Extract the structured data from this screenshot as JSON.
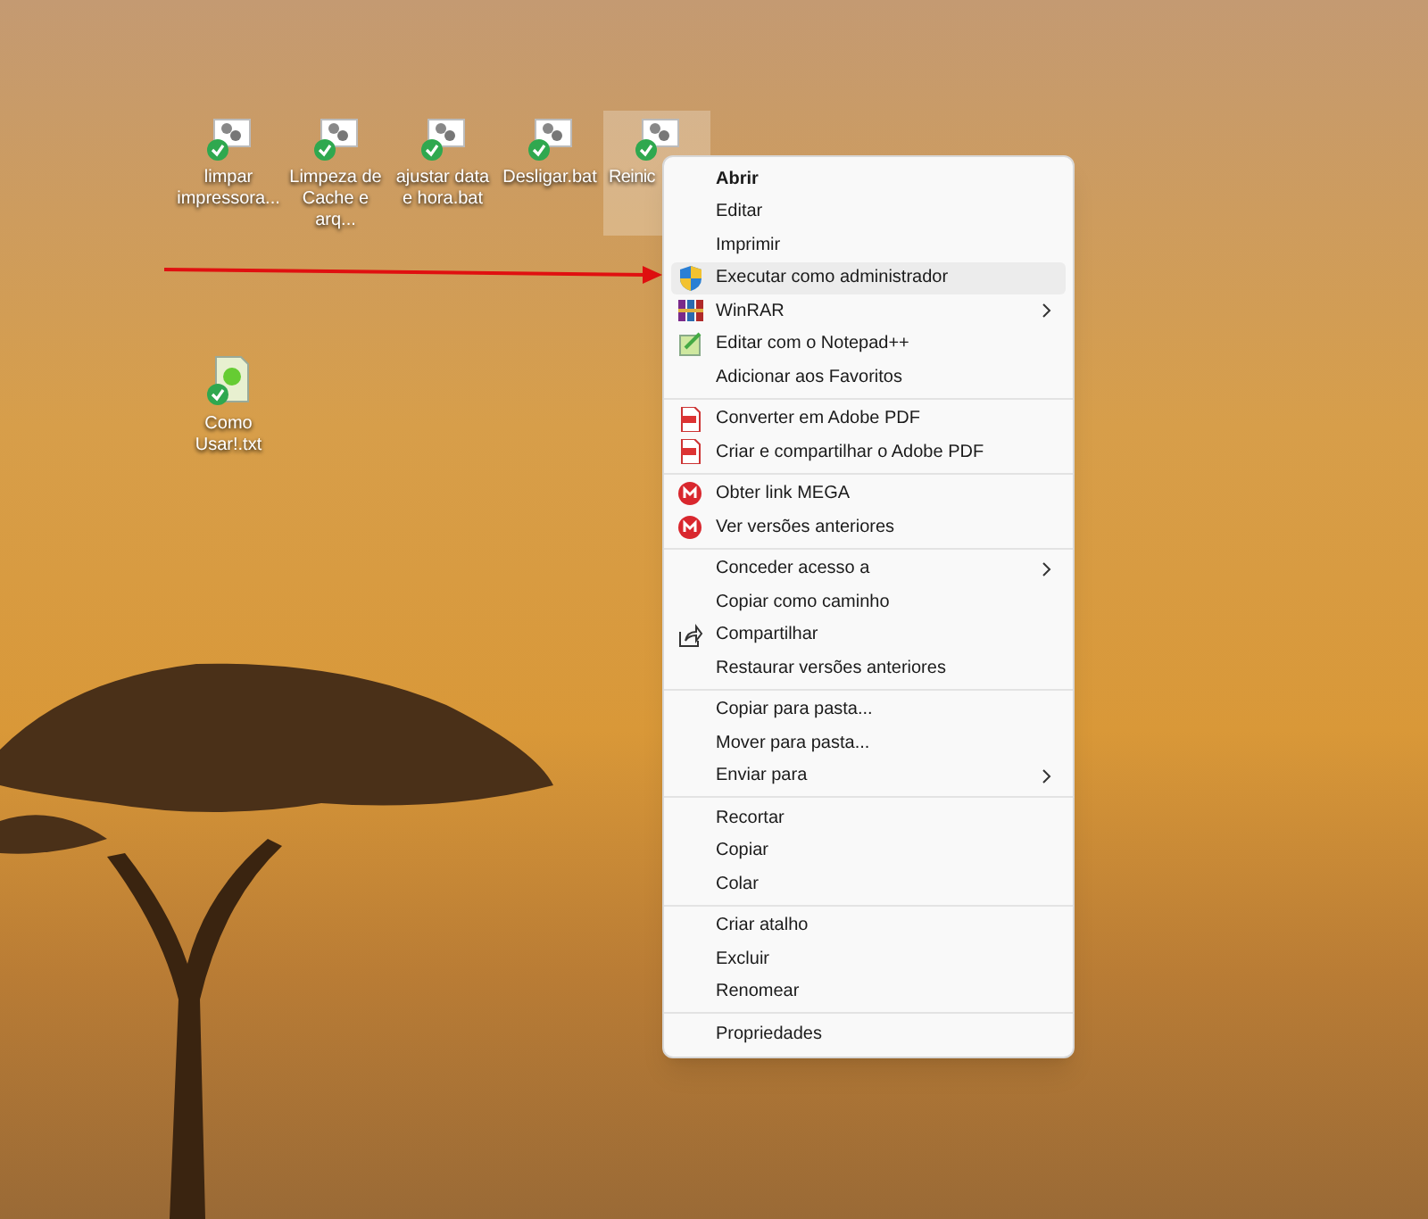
{
  "desktop_icons": [
    {
      "label": "limpar impressora...",
      "kind": "bat",
      "selected": false
    },
    {
      "label": "Limpeza de Cache e arq...",
      "kind": "bat",
      "selected": false
    },
    {
      "label": "ajustar data e hora.bat",
      "kind": "bat",
      "selected": false
    },
    {
      "label": "Desligar.bat",
      "kind": "bat",
      "selected": false
    },
    {
      "label": "Reinic",
      "kind": "bat",
      "selected": true
    }
  ],
  "desktop_icons_row_2": [
    {
      "label": "Como Usar!.txt",
      "kind": "txt",
      "selected": false
    }
  ],
  "context_menu": {
    "groups": [
      [
        {
          "label": "Abrir",
          "default": true,
          "selected": false
        },
        {
          "label": "Editar",
          "selected": false
        },
        {
          "label": "Imprimir",
          "selected": false
        },
        {
          "label": "Executar como administrador",
          "kind": "shield",
          "selected": true
        },
        {
          "label": "WinRAR",
          "kind": "winrar",
          "submenu": true,
          "selected": false
        },
        {
          "label": "Editar com o Notepad++",
          "kind": "notepad",
          "selected": false
        },
        {
          "label": "Adicionar aos Favoritos",
          "selected": false
        }
      ],
      [
        {
          "label": "Converter em Adobe PDF",
          "kind": "pdf",
          "selected": false
        },
        {
          "label": "Criar e compartilhar o Adobe PDF",
          "kind": "pdf",
          "selected": false
        }
      ],
      [
        {
          "label": "Obter link MEGA",
          "kind": "mega",
          "selected": false
        },
        {
          "label": "Ver versões anteriores",
          "kind": "mega",
          "selected": false
        }
      ],
      [
        {
          "label": "Conceder acesso a",
          "submenu": true,
          "selected": false
        },
        {
          "label": "Copiar como caminho",
          "selected": false
        },
        {
          "label": "Compartilhar",
          "kind": "share",
          "selected": false
        },
        {
          "label": "Restaurar versões anteriores",
          "selected": false
        }
      ],
      [
        {
          "label": "Copiar para pasta...",
          "selected": false
        },
        {
          "label": "Mover para pasta...",
          "selected": false
        },
        {
          "label": "Enviar para",
          "submenu": true,
          "selected": false
        }
      ],
      [
        {
          "label": "Recortar",
          "selected": false
        },
        {
          "label": "Copiar",
          "selected": false
        },
        {
          "label": "Colar",
          "selected": false
        }
      ],
      [
        {
          "label": "Criar atalho",
          "selected": false
        },
        {
          "label": "Excluir",
          "selected": false
        },
        {
          "label": "Renomear",
          "selected": false
        }
      ],
      [
        {
          "label": "Propriedades",
          "selected": false
        }
      ]
    ]
  }
}
